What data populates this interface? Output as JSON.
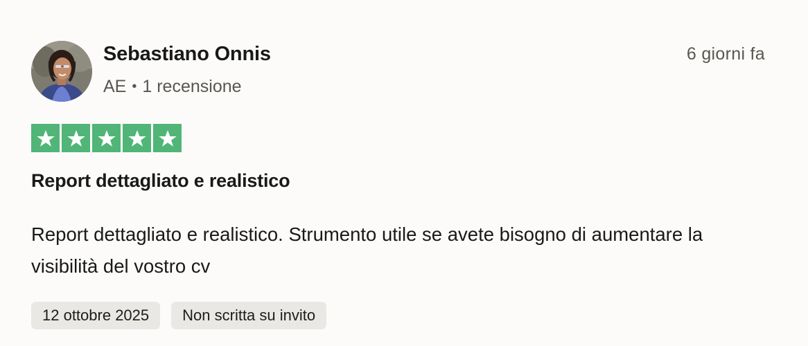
{
  "review": {
    "author": {
      "name": "Sebastiano Onnis",
      "country": "AE",
      "separator": "•",
      "review_count": "1 recensione"
    },
    "time_ago": "6 giorni fa",
    "rating": 5,
    "rating_max": 5,
    "title": "Report dettagliato e realistico",
    "body": "Report dettagliato e realistico. Strumento utile se avete bisogno di aumentare la visibilità del vostro cv",
    "date": "12 ottobre 2025",
    "invite_status": "Non scritta su invito"
  },
  "colors": {
    "star_fill": "#51b578",
    "chip_bg": "#e9e8e4",
    "muted_text": "#575752",
    "page_bg": "#fcfbf9"
  },
  "icons": {
    "avatar": "avatar-photo",
    "star": "star-icon"
  }
}
